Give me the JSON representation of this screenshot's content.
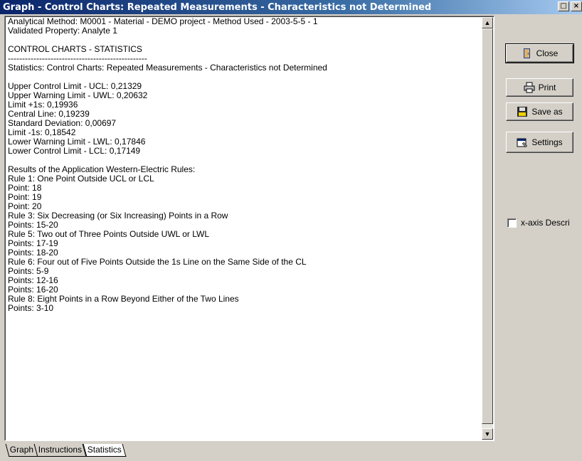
{
  "window": {
    "title": "Graph - Control Charts: Repeated Measurements - Characteristics not Determined",
    "controls": [
      "□",
      "×"
    ]
  },
  "report": {
    "lines": [
      "Analytical Method: M0001 - Material - DEMO project - Method Used - 2003-5-5 - 1",
      "Validated Property: Analyte 1",
      "",
      "CONTROL CHARTS - STATISTICS",
      "-------------------------------------------------",
      "Statistics: Control Charts: Repeated Measurements - Characteristics not Determined",
      "",
      "Upper Control Limit - UCL: 0,21329",
      "Upper Warning Limit - UWL: 0,20632",
      "Limit +1s: 0,19936",
      "Central Line: 0,19239",
      "Standard Deviation: 0,00697",
      "Limit -1s: 0,18542",
      "Lower Warning Limit - LWL: 0,17846",
      "Lower Control Limit - LCL: 0,17149",
      "",
      "Results of the Application Western-Electric Rules:",
      "Rule 1: One Point Outside UCL or LCL",
      "Point: 18",
      "Point: 19",
      "Point: 20",
      "Rule 3: Six Decreasing (or Six Increasing) Points in a Row",
      "Points: 15-20",
      "Rule 5: Two out of Three Points Outside UWL or LWL",
      "Points: 17-19",
      "Points: 18-20",
      "Rule 6: Four out of Five Points Outside the 1s Line on the Same Side of the CL",
      "Points: 5-9",
      "Points: 12-16",
      "Points: 16-20",
      "Rule 8: Eight Points in a Row Beyond Either of the Two Lines",
      "Points: 3-10"
    ]
  },
  "buttons": {
    "close": "Close",
    "print": "Print",
    "save_as": "Save as",
    "settings": "Settings"
  },
  "checkbox": {
    "label": "x-axis Descri",
    "checked": false
  },
  "tabs": [
    "Graph",
    "Instructions",
    "Statistics"
  ],
  "active_tab": "Statistics"
}
